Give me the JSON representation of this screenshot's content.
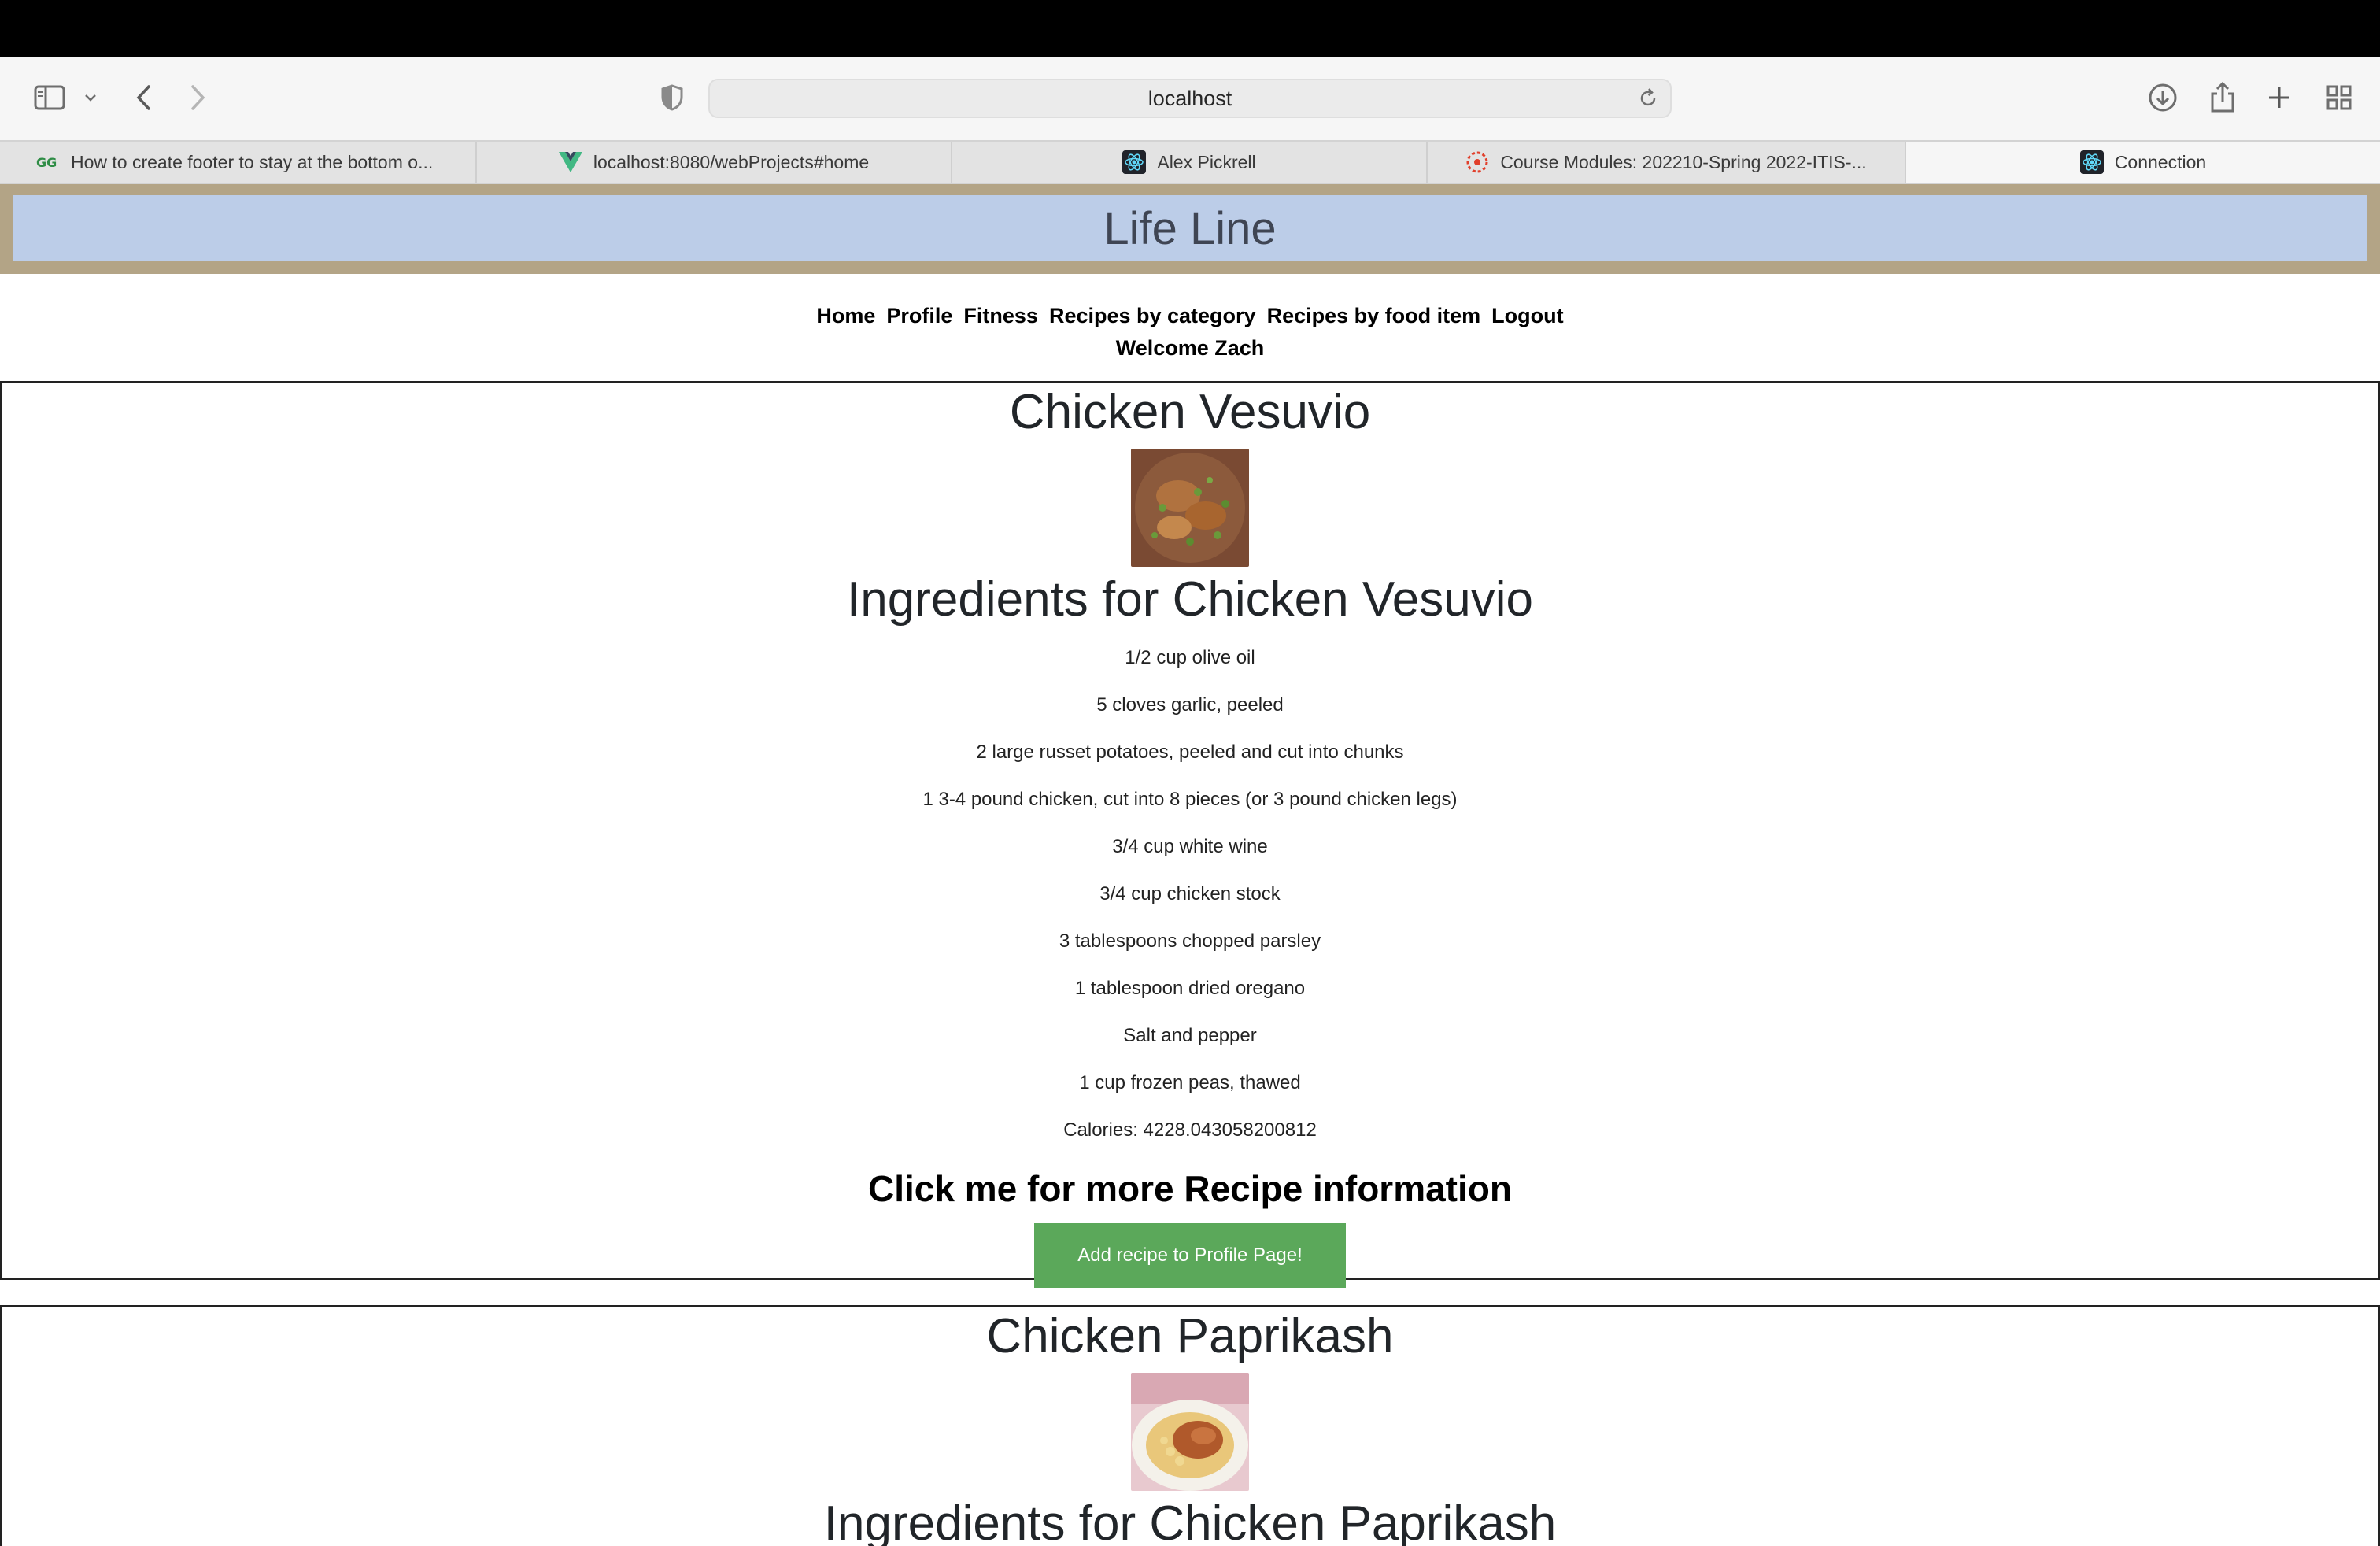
{
  "browser": {
    "address": "localhost",
    "tabs": [
      {
        "label": "How to create footer to stay at the bottom o...",
        "icon": "geeksforgeeks-favicon-icon",
        "active": false
      },
      {
        "label": "localhost:8080/webProjects#home",
        "icon": "vue-favicon-icon",
        "active": false
      },
      {
        "label": "Alex Pickrell",
        "icon": "react-favicon-icon",
        "active": false
      },
      {
        "label": "Course Modules: 202210-Spring 2022-ITIS-...",
        "icon": "canvas-favicon-icon",
        "active": false
      },
      {
        "label": "Connection",
        "icon": "react-favicon-icon",
        "active": true
      }
    ]
  },
  "app": {
    "title": "Life Line",
    "nav": {
      "home": "Home",
      "profile": "Profile",
      "fitness": "Fitness",
      "by_category": "Recipes by category",
      "by_food_item": "Recipes by food item",
      "logout": "Logout"
    },
    "welcome": "Welcome Zach"
  },
  "recipes": [
    {
      "name": "Chicken Vesuvio",
      "ingredients_title": "Ingredients for Chicken Vesuvio",
      "ingredients": [
        "1/2 cup olive oil",
        "5 cloves garlic, peeled",
        "2 large russet potatoes, peeled and cut into chunks",
        "1 3-4 pound chicken, cut into 8 pieces (or 3 pound chicken legs)",
        "3/4 cup white wine",
        "3/4 cup chicken stock",
        "3 tablespoons chopped parsley",
        "1 tablespoon dried oregano",
        "Salt and pepper",
        "1 cup frozen peas, thawed"
      ],
      "calories": "Calories: 4228.043058200812",
      "more_info": "Click me for more Recipe information",
      "add_button": "Add recipe to Profile Page!"
    },
    {
      "name": "Chicken Paprikash",
      "ingredients_title": "Ingredients for Chicken Paprikash"
    }
  ],
  "colors": {
    "header_border": "#b3a486",
    "header_fill": "#bccde8",
    "add_button": "#5ba85a"
  }
}
